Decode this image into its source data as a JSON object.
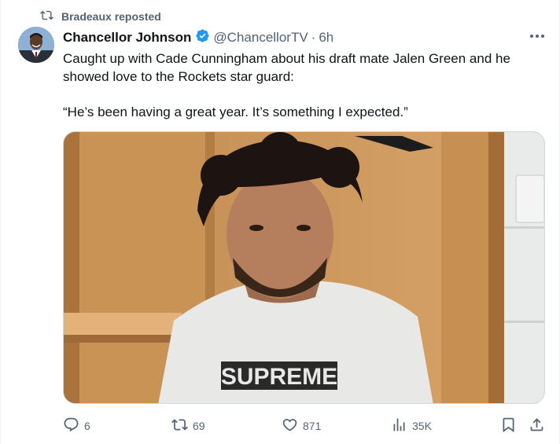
{
  "repost": {
    "label": "Bradeaux reposted",
    "icon": "repost-icon"
  },
  "author": {
    "name": "Chancellor Johnson",
    "handle": "@ChancellorTV",
    "separator": "·",
    "time": "6h",
    "verified": true
  },
  "tweet": {
    "text": "Caught up with Cade Cunningham about his draft mate Jalen Green and he showed love to the Rockets star guard:",
    "quote": "“He’s been having a great year. It’s something I expected.”"
  },
  "media": {
    "shirt_text": "SUPREME"
  },
  "actions": {
    "reply": {
      "icon": "reply-icon",
      "count": "6"
    },
    "repost": {
      "icon": "repost-icon",
      "count": "69"
    },
    "like": {
      "icon": "heart-icon",
      "count": "871"
    },
    "views": {
      "icon": "views-icon",
      "count": "35K"
    },
    "bookmark": {
      "icon": "bookmark-icon"
    },
    "share": {
      "icon": "share-icon"
    }
  },
  "colors": {
    "text_primary": "#0f1419",
    "text_secondary": "#536471",
    "verified_blue": "#1d9bf0",
    "border": "#cfd9de"
  }
}
